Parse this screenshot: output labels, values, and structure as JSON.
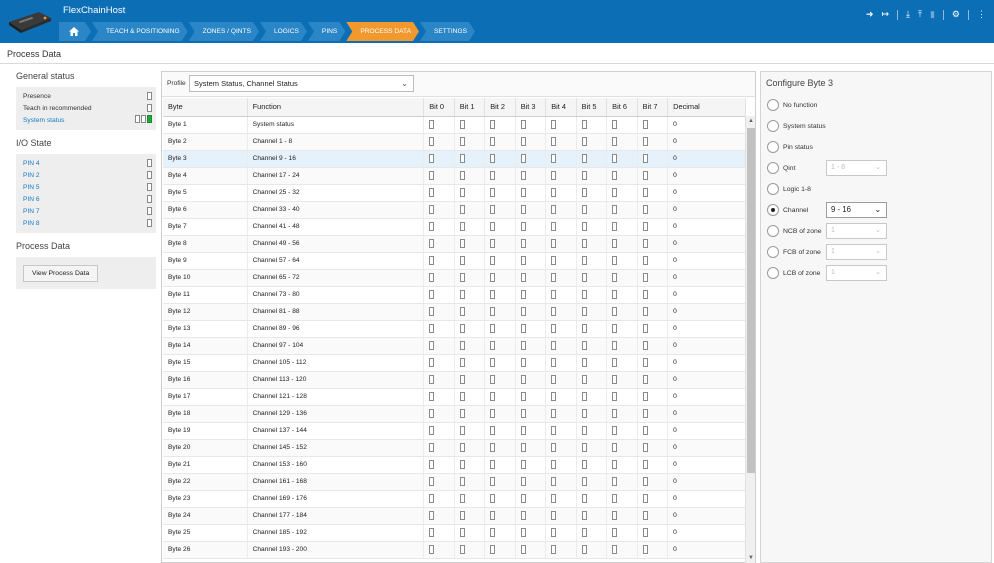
{
  "app": {
    "title": "FlexChainHost"
  },
  "nav": {
    "items": [
      {
        "label": "TEACH & POSITIONING"
      },
      {
        "label": "ZONES / QINTS"
      },
      {
        "label": "LOGICS"
      },
      {
        "label": "PINS"
      },
      {
        "label": "PROCESS DATA",
        "active": true
      },
      {
        "label": "SETTINGS"
      }
    ]
  },
  "toolbar": {
    "icons": [
      "login-icon",
      "logout-icon",
      "download-icon",
      "upload-icon",
      "delete-icon",
      "settings-icon",
      "more-icon"
    ]
  },
  "page": {
    "title": "Process Data"
  },
  "left": {
    "general_status_title": "General status",
    "general_status": [
      {
        "label": "Presence",
        "link": false
      },
      {
        "label": "Teach in recommended",
        "link": false
      },
      {
        "label": "System status",
        "link": true
      }
    ],
    "io_state_title": "I/O State",
    "pins": [
      "PIN 4",
      "PIN 2",
      "PIN 5",
      "PIN 6",
      "PIN 7",
      "PIN 8"
    ],
    "process_data_title": "Process Data",
    "view_button": "View Process Data"
  },
  "profile": {
    "label": "Profile",
    "value": "System Status, Channel Status"
  },
  "table": {
    "headers": [
      "Byte",
      "Function",
      "Bit 0",
      "Bit 1",
      "Bit 2",
      "Bit 3",
      "Bit 4",
      "Bit 5",
      "Bit 6",
      "Bit 7",
      "Decimal"
    ],
    "selected_row": 2,
    "rows": [
      {
        "byte": "Byte 1",
        "function": "System status",
        "decimal": "0"
      },
      {
        "byte": "Byte 2",
        "function": "Channel 1 - 8",
        "decimal": "0"
      },
      {
        "byte": "Byte 3",
        "function": "Channel 9 - 16",
        "decimal": "0"
      },
      {
        "byte": "Byte 4",
        "function": "Channel 17 - 24",
        "decimal": "0"
      },
      {
        "byte": "Byte 5",
        "function": "Channel 25 - 32",
        "decimal": "0"
      },
      {
        "byte": "Byte 6",
        "function": "Channel 33 - 40",
        "decimal": "0"
      },
      {
        "byte": "Byte 7",
        "function": "Channel 41 - 48",
        "decimal": "0"
      },
      {
        "byte": "Byte 8",
        "function": "Channel 49 - 56",
        "decimal": "0"
      },
      {
        "byte": "Byte 9",
        "function": "Channel 57 - 64",
        "decimal": "0"
      },
      {
        "byte": "Byte 10",
        "function": "Channel 65 - 72",
        "decimal": "0"
      },
      {
        "byte": "Byte 11",
        "function": "Channel 73 - 80",
        "decimal": "0"
      },
      {
        "byte": "Byte 12",
        "function": "Channel 81 - 88",
        "decimal": "0"
      },
      {
        "byte": "Byte 13",
        "function": "Channel 89 - 96",
        "decimal": "0"
      },
      {
        "byte": "Byte 14",
        "function": "Channel 97 - 104",
        "decimal": "0"
      },
      {
        "byte": "Byte 15",
        "function": "Channel 105 - 112",
        "decimal": "0"
      },
      {
        "byte": "Byte 16",
        "function": "Channel 113 - 120",
        "decimal": "0"
      },
      {
        "byte": "Byte 17",
        "function": "Channel 121 - 128",
        "decimal": "0"
      },
      {
        "byte": "Byte 18",
        "function": "Channel 129 - 136",
        "decimal": "0"
      },
      {
        "byte": "Byte 19",
        "function": "Channel 137 - 144",
        "decimal": "0"
      },
      {
        "byte": "Byte 20",
        "function": "Channel 145 - 152",
        "decimal": "0"
      },
      {
        "byte": "Byte 21",
        "function": "Channel 153 - 160",
        "decimal": "0"
      },
      {
        "byte": "Byte 22",
        "function": "Channel 161 - 168",
        "decimal": "0"
      },
      {
        "byte": "Byte 23",
        "function": "Channel 169 - 176",
        "decimal": "0"
      },
      {
        "byte": "Byte 24",
        "function": "Channel 177 - 184",
        "decimal": "0"
      },
      {
        "byte": "Byte 25",
        "function": "Channel 185 - 192",
        "decimal": "0"
      },
      {
        "byte": "Byte 26",
        "function": "Channel 193 - 200",
        "decimal": "0"
      }
    ]
  },
  "configure": {
    "title": "Configure Byte 3",
    "options": [
      {
        "label": "No function",
        "checked": false
      },
      {
        "label": "System status",
        "checked": false
      },
      {
        "label": "Pin status",
        "checked": false
      },
      {
        "label": "Qint",
        "checked": false,
        "select": "1 - 8",
        "enabled": false
      },
      {
        "label": "Logic 1-8",
        "checked": false
      },
      {
        "label": "Channel",
        "checked": true,
        "select": "9 - 16",
        "enabled": true
      },
      {
        "label": "NCB of zone",
        "checked": false,
        "select": "1",
        "enabled": false
      },
      {
        "label": "FCB of zone",
        "checked": false,
        "select": "1",
        "enabled": false
      },
      {
        "label": "LCB of zone",
        "checked": false,
        "select": "1",
        "enabled": false
      }
    ]
  },
  "colors": {
    "header_blue": "#0c6fb6",
    "active_tab": "#f2992e",
    "link": "#1479c3",
    "status_green": "#22a63a"
  }
}
